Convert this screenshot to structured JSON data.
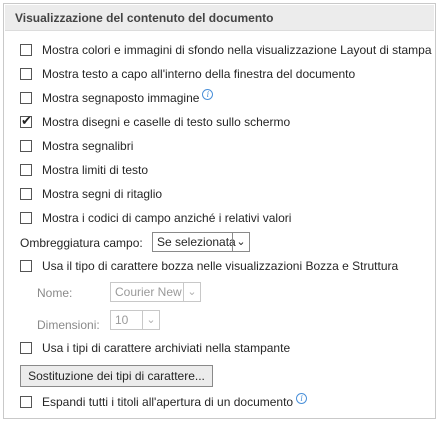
{
  "section": {
    "title": "Visualizzazione del contenuto del documento"
  },
  "options": [
    {
      "label": "Mostra colori e immagini di sfondo nella visualizzazione Layout di stampa",
      "checked": false
    },
    {
      "label": "Mostra testo a capo all'interno della finestra del documento",
      "checked": false
    },
    {
      "label": "Mostra segnaposto immagine",
      "checked": false,
      "info": true
    },
    {
      "label": "Mostra disegni e caselle di testo sullo schermo",
      "checked": true
    },
    {
      "label": "Mostra segnalibri",
      "checked": false
    },
    {
      "label": "Mostra limiti di testo",
      "checked": false
    },
    {
      "label": "Mostra segni di ritaglio",
      "checked": false
    },
    {
      "label": "Mostra i codici di campo anziché i relativi valori",
      "checked": false
    }
  ],
  "shading": {
    "label": "Ombreggiatura campo:",
    "value": "Se selezionata"
  },
  "draft_font": {
    "label": "Usa il tipo di carattere bozza nelle visualizzazioni Bozza e Struttura",
    "checked": false,
    "name_label": "Nome:",
    "name_value": "Courier New",
    "size_label": "Dimensioni:",
    "size_value": "10"
  },
  "printer_fonts": {
    "label": "Usa i tipi di carattere archiviati nella stampante",
    "checked": false
  },
  "font_substitution_button": "Sostituzione dei tipi di carattere...",
  "expand_headings": {
    "label": "Espandi tutti i titoli all'apertura di un documento",
    "checked": false,
    "info": true
  },
  "icons": {
    "checkmark": "✔",
    "dropdown": "⌄",
    "info": "i"
  }
}
